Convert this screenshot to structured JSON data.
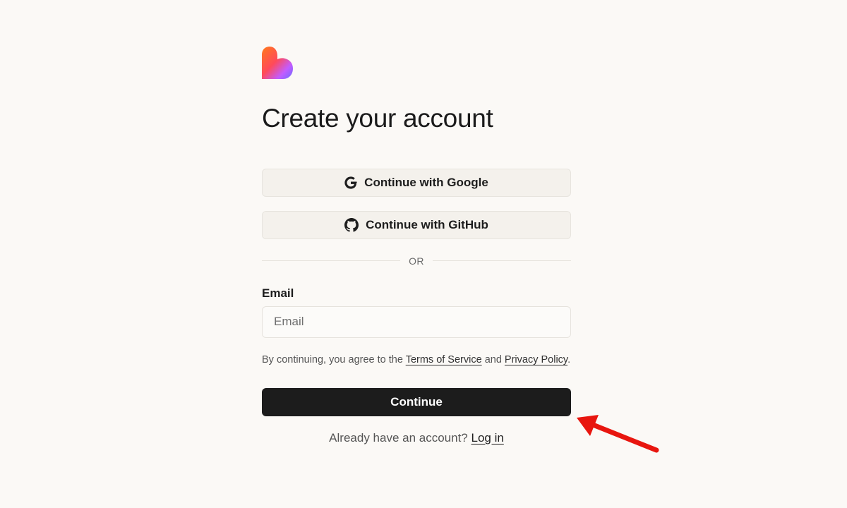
{
  "header": {
    "logo_icon": "heart-logo-icon",
    "title": "Create your account"
  },
  "oauth": {
    "google": {
      "label": "Continue with Google",
      "icon": "google-icon"
    },
    "github": {
      "label": "Continue with GitHub",
      "icon": "github-icon"
    }
  },
  "divider": {
    "text": "OR"
  },
  "email": {
    "label": "Email",
    "placeholder": "Email",
    "value": ""
  },
  "legal": {
    "prefix": "By continuing, you agree to the ",
    "terms_link": "Terms of Service",
    "middle": " and ",
    "privacy_link": "Privacy Policy",
    "suffix": "."
  },
  "continue_button": {
    "label": "Continue"
  },
  "login": {
    "prompt": "Already have an account? ",
    "link": "Log in"
  },
  "annotation": {
    "icon": "red-arrow-icon",
    "color": "#e8160f"
  },
  "colors": {
    "background": "#fbf9f6",
    "primary_button": "#1c1c1c",
    "oauth_button": "#f4f1ec"
  }
}
